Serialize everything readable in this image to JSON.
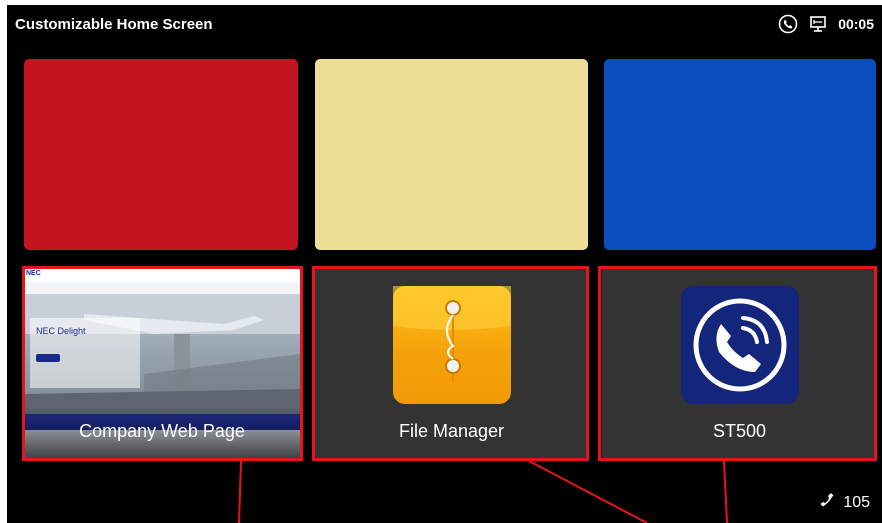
{
  "status_bar": {
    "title": "Customizable Home Screen",
    "clock": "00:05"
  },
  "tiles": [
    {
      "color": "#c3141f"
    },
    {
      "color": "#eedf97"
    },
    {
      "color": "#0b4dbd"
    }
  ],
  "apps": {
    "web": {
      "label": "Company Web Page",
      "thumbnail_heading": "NEC Delight",
      "thumbnail_logo": "NEC"
    },
    "files": {
      "label": "File Manager"
    },
    "phone": {
      "label": "ST500"
    }
  },
  "extension": {
    "number": "105"
  },
  "colors": {
    "highlight": "#e8141c",
    "background": "#000000"
  }
}
